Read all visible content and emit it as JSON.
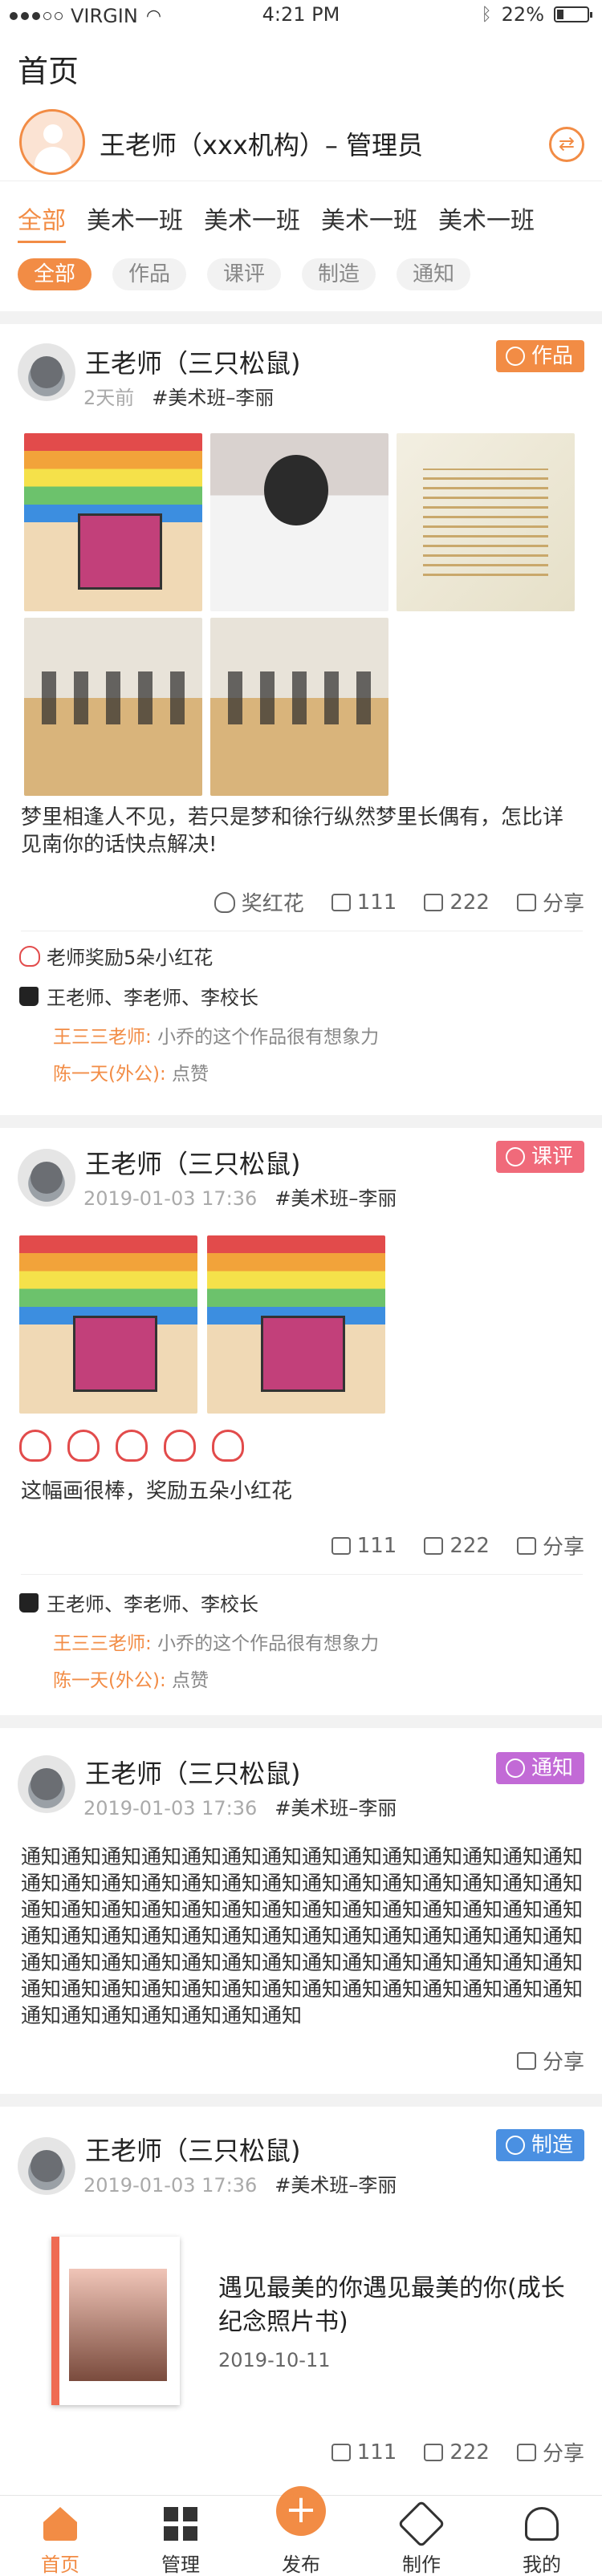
{
  "status_bar": {
    "carrier": "VIRGIN",
    "time": "4:21 PM",
    "battery": "22%",
    "battery_level": 0.22
  },
  "header": {
    "title": "首页",
    "user_name": "王老师（xxx机构）– 管理员"
  },
  "class_tabs": [
    "全部",
    "美术一班",
    "美术一班",
    "美术一班",
    "美术一班"
  ],
  "type_filters": [
    "全部",
    "作品",
    "课评",
    "制造",
    "通知"
  ],
  "posts": [
    {
      "author": "王老师（三只松鼠)",
      "time": "2天前",
      "class": "#美术班–李丽",
      "badge": "作品",
      "text": "梦里相逢人不见，若只是梦和徐行纵然梦里长偶有，怎比详见南你的话快点解决!",
      "actions": {
        "reward": "奖红花",
        "likes": "111",
        "comments": "222",
        "share": "分享"
      },
      "reward_line": "老师奖励5朵小红花",
      "liked_by": "王老师、李老师、李校长",
      "comments_list": [
        {
          "who": "王三三老师:",
          "what": "小乔的这个作品很有想象力"
        },
        {
          "who": "陈一天(外公):",
          "what": "点赞"
        }
      ]
    },
    {
      "author": "王老师（三只松鼠)",
      "time": "2019-01-03 17:36",
      "class": "#美术班–李丽",
      "badge": "课评",
      "text": "这幅画很棒，奖励五朵小红花",
      "actions": {
        "likes": "111",
        "comments": "222",
        "share": "分享"
      },
      "liked_by": "王老师、李老师、李校长",
      "comments_list": [
        {
          "who": "王三三老师:",
          "what": "小乔的这个作品很有想象力"
        },
        {
          "who": "陈一天(外公):",
          "what": "点赞"
        }
      ]
    },
    {
      "author": "王老师（三只松鼠)",
      "time": "2019-01-03 17:36",
      "class": "#美术班–李丽",
      "badge": "通知",
      "text": "通知通知通知通知通知通知通知通知通知通知通知通知通知通知通知通知通知通知通知通知通知通知通知通知通知通知通知通知通知通知通知通知通知通知通知通知通知通知通知通知通知通知通知通知通知通知通知通知通知通知通知通知通知通知通知通知通知通知通知通知通知通知通知通知通知通知通知通知通知通知通知通知通知通知通知通知通知通知通知通知通知通知通知通知通知通知通知通知通知通知通知",
      "actions": {
        "share": "分享"
      }
    },
    {
      "author": "王老师（三只松鼠)",
      "time": "2019-01-03 17:36",
      "class": "#美术班–李丽",
      "badge": "制造",
      "book_title": "遇见最美的你遇见最美的你(成长纪念照片书)",
      "book_date": "2019-10-11",
      "actions": {
        "likes": "111",
        "comments": "222",
        "share": "分享"
      }
    }
  ],
  "tab_bar": [
    "首页",
    "管理",
    "发布",
    "制作",
    "我的"
  ],
  "colors": {
    "accent": "#f28c45",
    "review": "#f06a7a",
    "notice": "#c26ad6",
    "make": "#4a90e2"
  }
}
